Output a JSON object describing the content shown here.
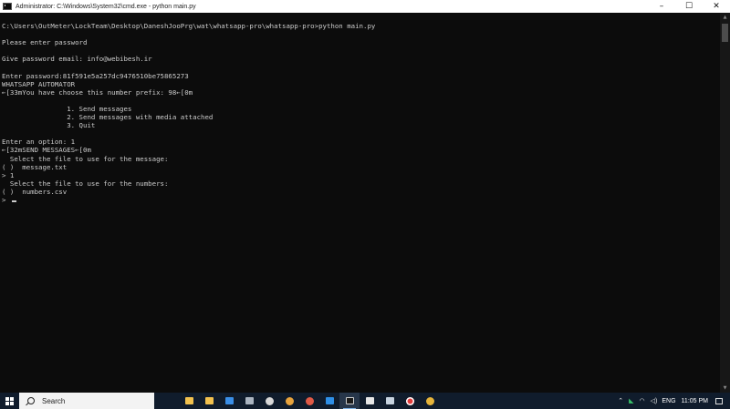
{
  "window": {
    "title": "Administrator: C:\\Windows\\System32\\cmd.exe - python  main.py",
    "controls": {
      "minimize": "–",
      "maximize": "☐",
      "close": "✕"
    }
  },
  "console": {
    "lines": [
      "C:\\Users\\OutMeter\\LockTeam\\Desktop\\DaneshJooPrg\\wat\\whatsapp-pro\\whatsapp-pro>python main.py",
      "",
      "Please enter password",
      "",
      "Give password email: info@webibesh.ir",
      "",
      "Enter password:81f591e5a257dc9476510be75865273",
      "WHATSAPP AUTOMATOR",
      "←[33mYou have choose this number prefix: 98←[0m",
      "",
      "                1. Send messages",
      "                2. Send messages with media attached",
      "                3. Quit",
      "",
      "Enter an option: 1",
      "←[32mSEND MESSAGES←[0m",
      "  Select the file to use for the message:",
      "( )  message.txt",
      "> 1",
      "  Select the file to use for the numbers:",
      "( )  numbers.csv",
      "> "
    ]
  },
  "taskbar": {
    "search_placeholder": "Search",
    "apps": [
      {
        "name": "file-explorer-icon",
        "color": "#f2c14e"
      },
      {
        "name": "store-icon",
        "color": "#f2c14e"
      },
      {
        "name": "mail-icon",
        "color": "#3a8ee6"
      },
      {
        "name": "settings-icon",
        "color": "#aab4c0"
      },
      {
        "name": "camera-icon",
        "color": "#d8d8d8"
      },
      {
        "name": "chrome-icon",
        "color": "#e8a33d"
      },
      {
        "name": "chrome-alt-icon",
        "color": "#e05a46"
      },
      {
        "name": "vscode-icon",
        "color": "#2f8fe6"
      },
      {
        "name": "terminal-icon",
        "color": "#cfcfcf"
      },
      {
        "name": "notes-icon",
        "color": "#e6e6e6"
      },
      {
        "name": "photos-icon",
        "color": "#c7d3df"
      },
      {
        "name": "record-icon",
        "color": "#e23a3a"
      },
      {
        "name": "browser-icon",
        "color": "#e6b43a"
      }
    ],
    "tray": {
      "network_label": "",
      "language": "ENG",
      "time": "11:05 PM"
    }
  }
}
